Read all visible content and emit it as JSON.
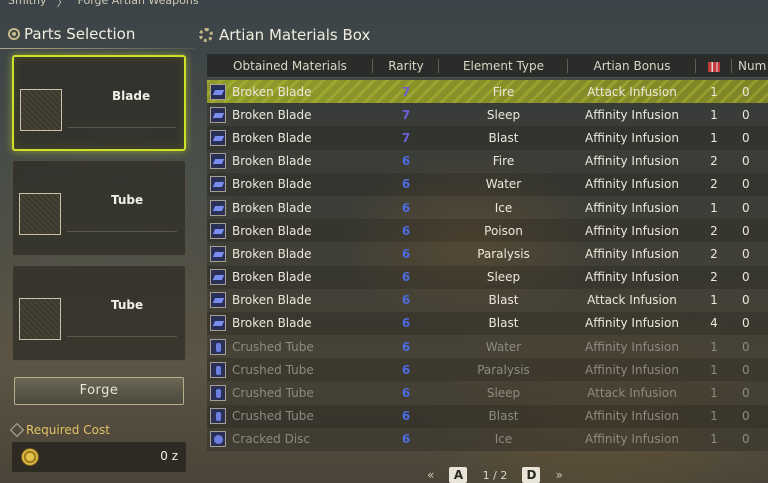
{
  "breadcrumb": [
    "Smithy",
    "Forge Artian Weapons"
  ],
  "left": {
    "title": "Parts Selection",
    "parts": [
      {
        "label": "Blade",
        "selected": true
      },
      {
        "label": "Tube",
        "selected": false
      },
      {
        "label": "Tube",
        "selected": false
      }
    ],
    "forge_label": "Forge",
    "cost_label": "Required Cost",
    "cost_value": "0 z"
  },
  "right": {
    "title": "Artian Materials Box",
    "headers": {
      "name": "Obtained Materials",
      "rarity": "Rarity",
      "element": "Element Type",
      "bonus": "Artian Bonus",
      "count_icon": "owned-count-icon",
      "num": "Num"
    },
    "rows": [
      {
        "name": "Broken Blade",
        "icon": "blade",
        "rarity": "7",
        "element": "Fire",
        "bonus": "Attack Infusion",
        "count": "1",
        "num": "0",
        "selected": true,
        "dim": false
      },
      {
        "name": "Broken Blade",
        "icon": "blade",
        "rarity": "7",
        "element": "Sleep",
        "bonus": "Affinity Infusion",
        "count": "1",
        "num": "0",
        "selected": false,
        "dim": false
      },
      {
        "name": "Broken Blade",
        "icon": "blade",
        "rarity": "7",
        "element": "Blast",
        "bonus": "Affinity Infusion",
        "count": "1",
        "num": "0",
        "selected": false,
        "dim": false
      },
      {
        "name": "Broken Blade",
        "icon": "blade",
        "rarity": "6",
        "element": "Fire",
        "bonus": "Affinity Infusion",
        "count": "2",
        "num": "0",
        "selected": false,
        "dim": false
      },
      {
        "name": "Broken Blade",
        "icon": "blade",
        "rarity": "6",
        "element": "Water",
        "bonus": "Affinity Infusion",
        "count": "2",
        "num": "0",
        "selected": false,
        "dim": false
      },
      {
        "name": "Broken Blade",
        "icon": "blade",
        "rarity": "6",
        "element": "Ice",
        "bonus": "Affinity Infusion",
        "count": "1",
        "num": "0",
        "selected": false,
        "dim": false
      },
      {
        "name": "Broken Blade",
        "icon": "blade",
        "rarity": "6",
        "element": "Poison",
        "bonus": "Affinity Infusion",
        "count": "2",
        "num": "0",
        "selected": false,
        "dim": false
      },
      {
        "name": "Broken Blade",
        "icon": "blade",
        "rarity": "6",
        "element": "Paralysis",
        "bonus": "Affinity Infusion",
        "count": "2",
        "num": "0",
        "selected": false,
        "dim": false
      },
      {
        "name": "Broken Blade",
        "icon": "blade",
        "rarity": "6",
        "element": "Sleep",
        "bonus": "Affinity Infusion",
        "count": "2",
        "num": "0",
        "selected": false,
        "dim": false
      },
      {
        "name": "Broken Blade",
        "icon": "blade",
        "rarity": "6",
        "element": "Blast",
        "bonus": "Attack Infusion",
        "count": "1",
        "num": "0",
        "selected": false,
        "dim": false
      },
      {
        "name": "Broken Blade",
        "icon": "blade",
        "rarity": "6",
        "element": "Blast",
        "bonus": "Affinity Infusion",
        "count": "4",
        "num": "0",
        "selected": false,
        "dim": false
      },
      {
        "name": "Crushed Tube",
        "icon": "tube",
        "rarity": "6",
        "element": "Water",
        "bonus": "Affinity Infusion",
        "count": "1",
        "num": "0",
        "selected": false,
        "dim": true
      },
      {
        "name": "Crushed Tube",
        "icon": "tube",
        "rarity": "6",
        "element": "Paralysis",
        "bonus": "Affinity Infusion",
        "count": "1",
        "num": "0",
        "selected": false,
        "dim": true
      },
      {
        "name": "Crushed Tube",
        "icon": "tube",
        "rarity": "6",
        "element": "Sleep",
        "bonus": "Attack Infusion",
        "count": "1",
        "num": "0",
        "selected": false,
        "dim": true
      },
      {
        "name": "Crushed Tube",
        "icon": "tube",
        "rarity": "6",
        "element": "Blast",
        "bonus": "Affinity Infusion",
        "count": "1",
        "num": "0",
        "selected": false,
        "dim": true
      },
      {
        "name": "Cracked Disc",
        "icon": "disc",
        "rarity": "6",
        "element": "Ice",
        "bonus": "Affinity Infusion",
        "count": "1",
        "num": "0",
        "selected": false,
        "dim": true
      }
    ],
    "pager": {
      "prev_key": "A",
      "page": "1 / 2",
      "next_key": "D"
    }
  },
  "colors": {
    "selected_border": "#cde026",
    "rarity7": "#6a62d8",
    "rarity6": "#4d6ce0",
    "cost_label": "#e2c265"
  }
}
